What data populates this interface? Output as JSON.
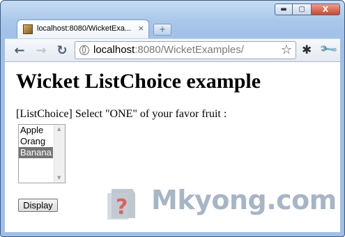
{
  "browser": {
    "tab_title": "localhost:8080/WicketExa...",
    "tab_close": "×",
    "new_tab": "+",
    "controls": {
      "minimize": "▬",
      "maximize": "▢",
      "close": "X"
    },
    "nav": {
      "back": "←",
      "forward": "→",
      "reload": "↻"
    },
    "url_host": "localhost",
    "url_rest": ":8080/WicketExamples/",
    "icons": [
      "globe-icon",
      "star-icon",
      "bug-icon",
      "wrench-icon"
    ]
  },
  "page": {
    "heading": "Wicket ListChoice example",
    "prompt": "[ListChoice] Select \"ONE\" of your favor fruit :",
    "list_options": [
      "Apple",
      "Orang",
      "Banana"
    ],
    "selected_option": "Banana",
    "display_button": "Display"
  },
  "watermark": {
    "text": "Mkyong.com",
    "icon_glyph": "?",
    "colors": {
      "gray": "#aab4bf",
      "red": "#d9534f"
    }
  },
  "colors": {
    "selection": "#757575",
    "frame": "#a9c6ea"
  }
}
